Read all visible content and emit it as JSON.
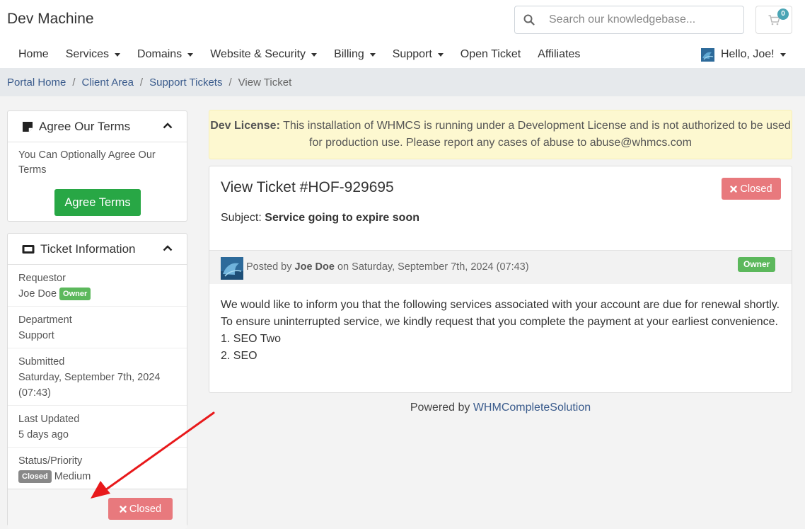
{
  "header": {
    "brand": "Dev Machine",
    "search_placeholder": "Search our knowledgebase...",
    "cart_count": "0",
    "nav": [
      {
        "label": "Home",
        "dropdown": false
      },
      {
        "label": "Services",
        "dropdown": true
      },
      {
        "label": "Domains",
        "dropdown": true
      },
      {
        "label": "Website & Security",
        "dropdown": true
      },
      {
        "label": "Billing",
        "dropdown": true
      },
      {
        "label": "Support",
        "dropdown": true
      },
      {
        "label": "Open Ticket",
        "dropdown": false
      },
      {
        "label": "Affiliates",
        "dropdown": false
      }
    ],
    "user_greeting": "Hello, Joe!"
  },
  "breadcrumb": {
    "items": [
      "Portal Home",
      "Client Area",
      "Support Tickets"
    ],
    "active": "View Ticket",
    "separator": "/"
  },
  "sidebar": {
    "terms": {
      "title": "Agree Our Terms",
      "text": "You Can Optionally Agree Our Terms",
      "button": "Agree Terms"
    },
    "ticket_info": {
      "title": "Ticket Information",
      "requestor_label": "Requestor",
      "requestor_value": "Joe Doe",
      "requestor_badge": "Owner",
      "department_label": "Department",
      "department_value": "Support",
      "submitted_label": "Submitted",
      "submitted_value": "Saturday, September 7th, 2024 (07:43)",
      "updated_label": "Last Updated",
      "updated_value": "5 days ago",
      "status_label": "Status/Priority",
      "status_badge": "Closed",
      "priority_value": "Medium",
      "closed_button": "Closed"
    }
  },
  "license": {
    "label": "Dev License:",
    "text": " This installation of WHMCS is running under a Development License and is not authorized to be used for production use. Please report any cases of abuse to abuse@whmcs.com"
  },
  "ticket": {
    "title": "View Ticket #HOF-929695",
    "status_button": "Closed",
    "subject_label": "Subject:",
    "subject_value": "Service going to expire soon",
    "post": {
      "prefix": "Posted by",
      "author": "Joe Doe",
      "date_text": "on Saturday, September 7th, 2024 (07:43)",
      "badge": "Owner",
      "message": [
        "We would like to inform you that the following services associated with your account are due for renewal shortly. To ensure uninterrupted service, we kindly request that you complete the payment at your earliest convenience.",
        "1. SEO Two",
        "2. SEO"
      ]
    }
  },
  "footer": {
    "powered_prefix": "Powered by",
    "powered_link": "WHMCompleteSolution"
  },
  "colors": {
    "accent_link": "#3a5b8c",
    "success": "#28a745",
    "danger_light": "#e8797d",
    "license_bg": "#fdf8d0",
    "annotation_arrow": "#e8191b"
  }
}
